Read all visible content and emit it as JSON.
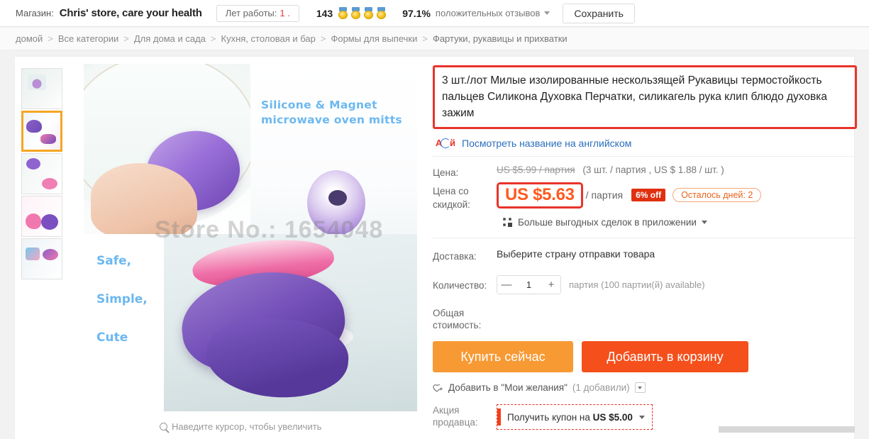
{
  "store_bar": {
    "store_label": "Магазин:",
    "store_name": "Chris' store, care your health",
    "years_label": "Лет работы:",
    "years_value": "1 .",
    "feedback_count": "143",
    "medal_count": 4,
    "positive_percent": "97.1%",
    "positive_label": "положительных отзывов",
    "save_button": "Сохранить"
  },
  "breadcrumb": {
    "items": [
      {
        "label": "домой"
      },
      {
        "label": "Все категории"
      },
      {
        "label": "Для дома и сада"
      },
      {
        "label": "Кухня, столовая и бар"
      },
      {
        "label": "Формы для выпечки"
      },
      {
        "label": "Фартуки, рукавицы и прихватки"
      }
    ],
    "separator": ">"
  },
  "gallery": {
    "thumbnails": [
      {
        "name": "thumb-1"
      },
      {
        "name": "thumb-2",
        "selected": true
      },
      {
        "name": "thumb-3"
      },
      {
        "name": "thumb-4"
      },
      {
        "name": "thumb-5"
      }
    ],
    "main_image": {
      "overlay_title": "Silicone & Magnet microwave oven mitts",
      "watermark": "Store No.: 1654048",
      "feature_lines": [
        "Safe,",
        "Simple,",
        "Cute"
      ]
    },
    "zoom_hint": "Наведите курсор, чтобы увеличить"
  },
  "product": {
    "title": "3 шт./лот Милые изолированные нескользящей Рукавицы термостойкость пальцев Силикона Духовка Перчатки, силикагель рука клип блюдо духовка зажим",
    "translate_link": "Посмотреть название на английском",
    "price": {
      "label": "Цена:",
      "original": "US $5.99 / партия",
      "breakdown": "(3 шт. / партия , US $ 1.88 / шт. )",
      "discount_label": "Цена со скидкой:",
      "discount_value": "US $5.63",
      "per_unit": "/ партия",
      "off_badge": "6% off",
      "days_left": "Осталось дней: 2"
    },
    "app_deals": "Больше выгодных сделок в приложении",
    "shipping": {
      "label": "Доставка:",
      "value": "Выберите страну отправки товара"
    },
    "quantity": {
      "label": "Количество:",
      "value": "1",
      "minus": "—",
      "plus": "+",
      "note": "партия (100 партии(й) available)"
    },
    "total": {
      "label": "Общая стоимость:",
      "value": ""
    },
    "buttons": {
      "buy_now": "Купить сейчас",
      "add_to_cart": "Добавить в корзину"
    },
    "wishlist": {
      "label": "Добавить в \"Мои желания\"",
      "count": "(1 добавили)"
    },
    "promo": {
      "label": "Акция продавца:",
      "coupon_prefix": "Получить купон на",
      "coupon_amount": "US $5.00"
    }
  },
  "colors": {
    "accent_red": "#e8342a",
    "price_orange": "#ff5a1f",
    "buy_orange": "#f79a34",
    "cart_orange": "#f5501c",
    "link_blue": "#2a6ebb",
    "thumb_selected": "#f5a623"
  }
}
